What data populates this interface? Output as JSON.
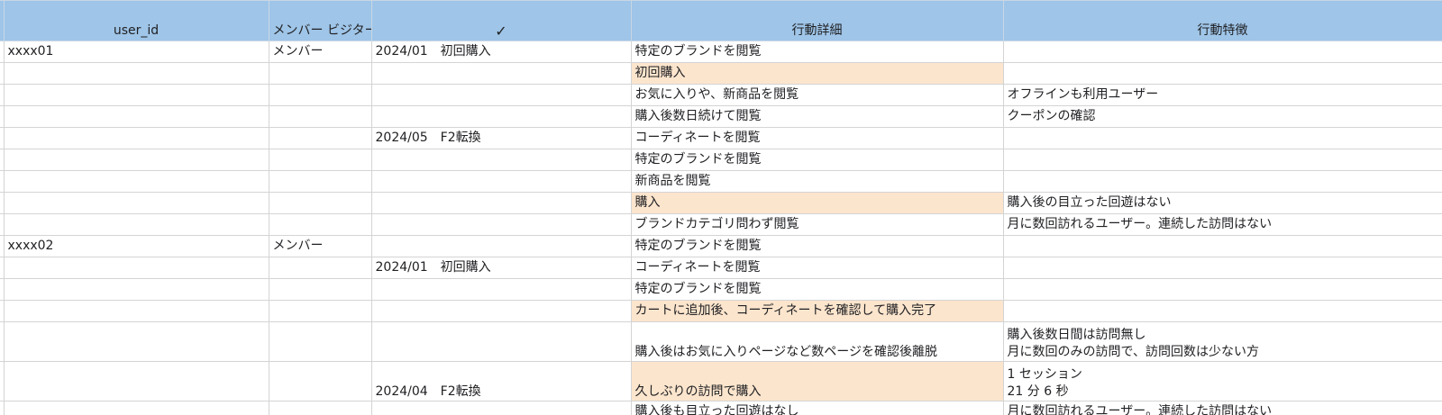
{
  "header": {
    "user_id": "user_id",
    "member_line1": "メンバー",
    "member_line2": "ビジター",
    "check": "✓",
    "action_detail": "行動詳細",
    "action_feature": "行動特徴"
  },
  "rows": [
    {
      "user": "xxxx01",
      "member": "メンバー",
      "milestone": "2024/01　初回購入",
      "detail": "特定のブランドを閲覧",
      "feature": ""
    },
    {
      "user": "",
      "member": "",
      "milestone": "",
      "detail": "初回購入",
      "feature": ""
    },
    {
      "user": "",
      "member": "",
      "milestone": "",
      "detail": "お気に入りや、新商品を閲覧",
      "feature": "オフラインも利用ユーザー"
    },
    {
      "user": "",
      "member": "",
      "milestone": "",
      "detail": "購入後数日続けて閲覧",
      "feature": "クーポンの確認"
    },
    {
      "user": "",
      "member": "",
      "milestone": "2024/05　F2転換",
      "detail": "コーディネートを閲覧",
      "feature": ""
    },
    {
      "user": "",
      "member": "",
      "milestone": "",
      "detail": "特定のブランドを閲覧",
      "feature": ""
    },
    {
      "user": "",
      "member": "",
      "milestone": "",
      "detail": "新商品を閲覧",
      "feature": ""
    },
    {
      "user": "",
      "member": "",
      "milestone": "",
      "detail": "購入",
      "feature": "購入後の目立った回遊はない"
    },
    {
      "user": "",
      "member": "",
      "milestone": "",
      "detail": "ブランドカテゴリ問わず閲覧",
      "feature": "月に数回訪れるユーザー。連続した訪問はない"
    },
    {
      "user": "xxxx02",
      "member": "メンバー",
      "milestone": "",
      "detail": "特定のブランドを閲覧",
      "feature": ""
    },
    {
      "user": "",
      "member": "",
      "milestone": "2024/01　初回購入",
      "detail": "コーディネートを閲覧",
      "feature": ""
    },
    {
      "user": "",
      "member": "",
      "milestone": "",
      "detail": "特定のブランドを閲覧",
      "feature": ""
    },
    {
      "user": "",
      "member": "",
      "milestone": "",
      "detail": "カートに追加後、コーディネートを確認して購入完了",
      "feature": ""
    },
    {
      "user": "",
      "member": "",
      "milestone": "",
      "detail": "購入後はお気に入りページなど数ページを確認後離脱",
      "feature": "購入後数日間は訪問無し",
      "feature2": "月に数回のみの訪問で、訪問回数は少ない方"
    },
    {
      "user": "",
      "member": "",
      "milestone": "2024/04　F2転換",
      "detail": "久しぶりの訪問で購入",
      "feature": "1 セッション",
      "feature2": "21 分 6 秒"
    },
    {
      "user": "",
      "member": "",
      "milestone": "",
      "detail": "購入後も目立った回遊はなし",
      "feature": "月に数回訪れるユーザー。連続した訪問はない"
    }
  ],
  "colors": {
    "header_bg": "#9fc5e8",
    "highlight_bg": "#fce5cd",
    "grid_line": "#d4d4d4"
  }
}
